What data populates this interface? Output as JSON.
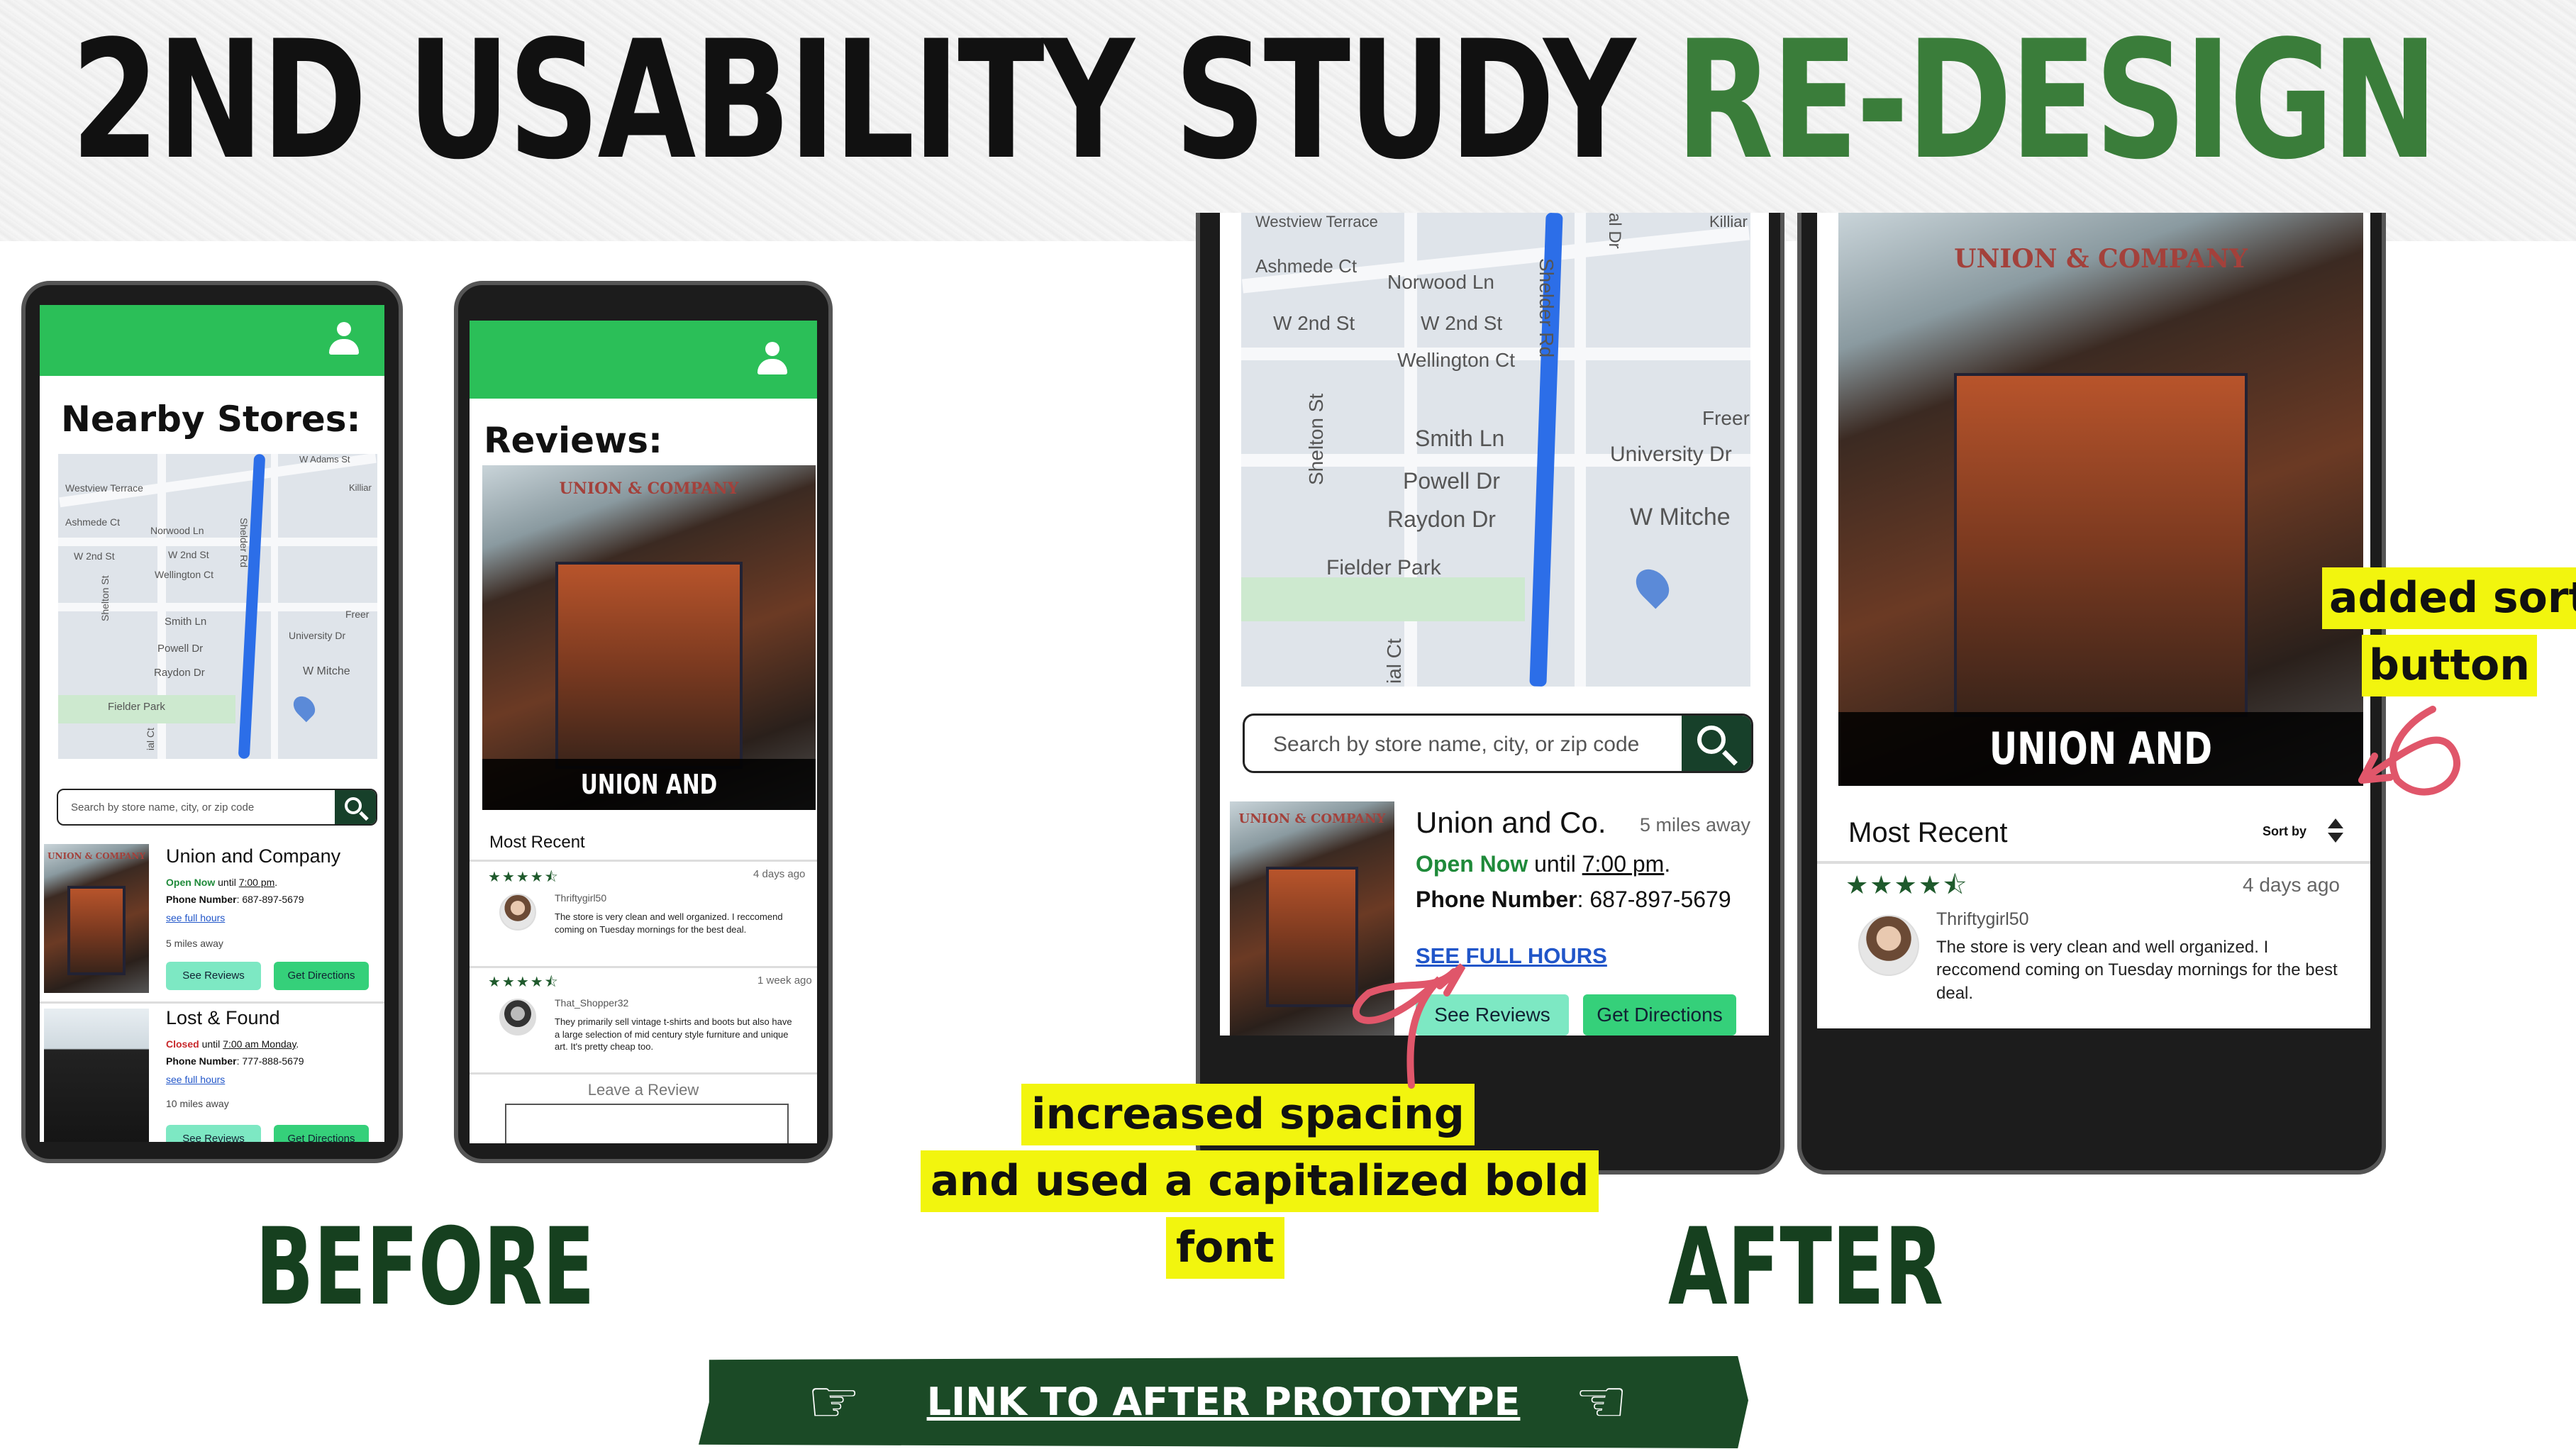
{
  "header": {
    "title_main": "2ND USABILITY STUDY ",
    "title_accent": "RE-DESIGN"
  },
  "before_label": "BEFORE",
  "after_label": "AFTER",
  "before_stores": {
    "heading": "Nearby Stores:",
    "map_labels": [
      "Westview Terrace",
      "Ashmede Ct",
      "Norwood Ln",
      "W 2nd St",
      "W 2nd St",
      "Wellington Ct",
      "Smith Ln",
      "Powell Dr",
      "Raydon Dr",
      "Fielder Park",
      "Freer",
      "University Dr",
      "W Mitche",
      "W Adams St",
      "Killiar",
      "Shelton St",
      "Shelder Rd",
      "ial Ct"
    ],
    "search_placeholder": "Search by store name, city, or zip code",
    "stores": [
      {
        "name": "Union and Company",
        "status": "Open Now",
        "until_text": " until ",
        "time": "7:00 pm",
        "time_suffix": ".",
        "phone_label": "Phone Number",
        "phone": ": 687-897-5679",
        "hours_link": "see full hours",
        "distance": "5 miles away",
        "btn_reviews": "See Reviews",
        "btn_directions": "Get Directions",
        "sign": "UNION & COMPANY"
      },
      {
        "name": "Lost & Found",
        "status": "Closed",
        "until_text": " until ",
        "time": "7:00 am Monday",
        "time_suffix": ".",
        "phone_label": "Phone Number",
        "phone": ": 777-888-5679",
        "hours_link": "see full hours",
        "distance": "10 miles away",
        "btn_reviews": "See Reviews",
        "btn_directions": "Get Directions"
      }
    ]
  },
  "before_reviews": {
    "heading": "Reviews:",
    "banner": "UNION AND COMPANY",
    "sign": "UNION & COMPANY",
    "filter": "Most Recent",
    "reviews": [
      {
        "stars": "★★★★⯪",
        "age": "4 days ago",
        "user": "Thriftygirl50",
        "text": "The store is very clean and well organized. I reccomend coming on Tuesday mornings for the best deal."
      },
      {
        "stars": "★★★★⯪",
        "age": "1 week ago",
        "user": "That_Shopper32",
        "text": "They primarily sell vintage t-shirts and boots but also have a large selection of mid century style furniture and unique art. It's pretty cheap too."
      }
    ],
    "leave_review": "Leave a Review"
  },
  "after_stores": {
    "map_labels": [
      "Westview Terrace",
      "Ashmede Ct",
      "Norwood Ln",
      "W 2nd St",
      "W 2nd St",
      "Wellington Ct",
      "Smith Ln",
      "Powell Dr",
      "Raydon Dr",
      "Fielder Park",
      "Freer",
      "University Dr",
      "W Mitche",
      "Shelton St",
      "Shelder Rd",
      "Killiar",
      "ial Ct",
      "al Dr"
    ],
    "search_placeholder": "Search by store name, city, or zip code",
    "store": {
      "name": "Union and Co.",
      "distance": "5 miles away",
      "status": "Open Now",
      "until_text": " until ",
      "time": "7:00 pm",
      "time_suffix": ".",
      "phone_label": "Phone Number",
      "phone": ": 687-897-5679",
      "hours_link": "SEE FULL HOURS",
      "btn_reviews": "See Reviews",
      "btn_directions": "Get Directions",
      "sign": "UNION & COMPANY"
    }
  },
  "after_reviews": {
    "banner": "UNION AND COMPANY",
    "sign": "UNION & COMPANY",
    "filter": "Most Recent",
    "sort": "Sort by",
    "review": {
      "stars": "★★★★⯪",
      "age": "4 days ago",
      "user": "Thriftygirl50",
      "text": "The store is very clean and well organized. I reccomend coming on Tuesday mornings for the best deal."
    }
  },
  "callouts": {
    "sort_line1": "added sort",
    "sort_line2": "button",
    "spacing_line1": "increased spacing",
    "spacing_line2": "and used a capitalized bold",
    "spacing_line3": "font"
  },
  "link": "LINK TO AFTER PROTOTYPE",
  "icons": {
    "hand_left": "☞",
    "hand_right": "☜"
  },
  "colors": {
    "accent_green": "#3a7d3a",
    "dark_green": "#16401f",
    "topbar_green": "#2bbf58",
    "chip_mint": "#7de8c3",
    "callout_yellow": "#f2f50e",
    "link_blue": "#2156c9"
  }
}
